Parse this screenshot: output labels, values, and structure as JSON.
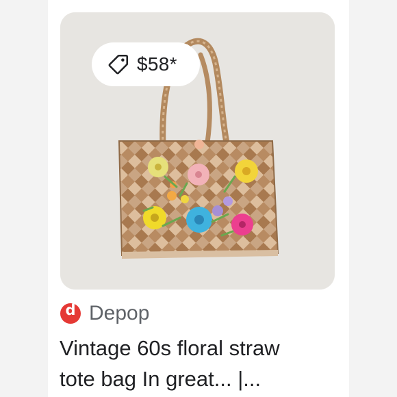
{
  "listing": {
    "price": "$58*",
    "source": "Depop",
    "source_initial": "d",
    "title_line1": "Vintage 60s floral straw",
    "title_line2": "tote bag In great... |..."
  },
  "icons": {
    "price_tag": "price-tag-icon",
    "source_logo": "depop-logo-icon"
  },
  "colors": {
    "card_background": "#ffffff",
    "text_primary": "#202124",
    "text_secondary": "#5f6368",
    "depop_brand": "#e53935"
  }
}
